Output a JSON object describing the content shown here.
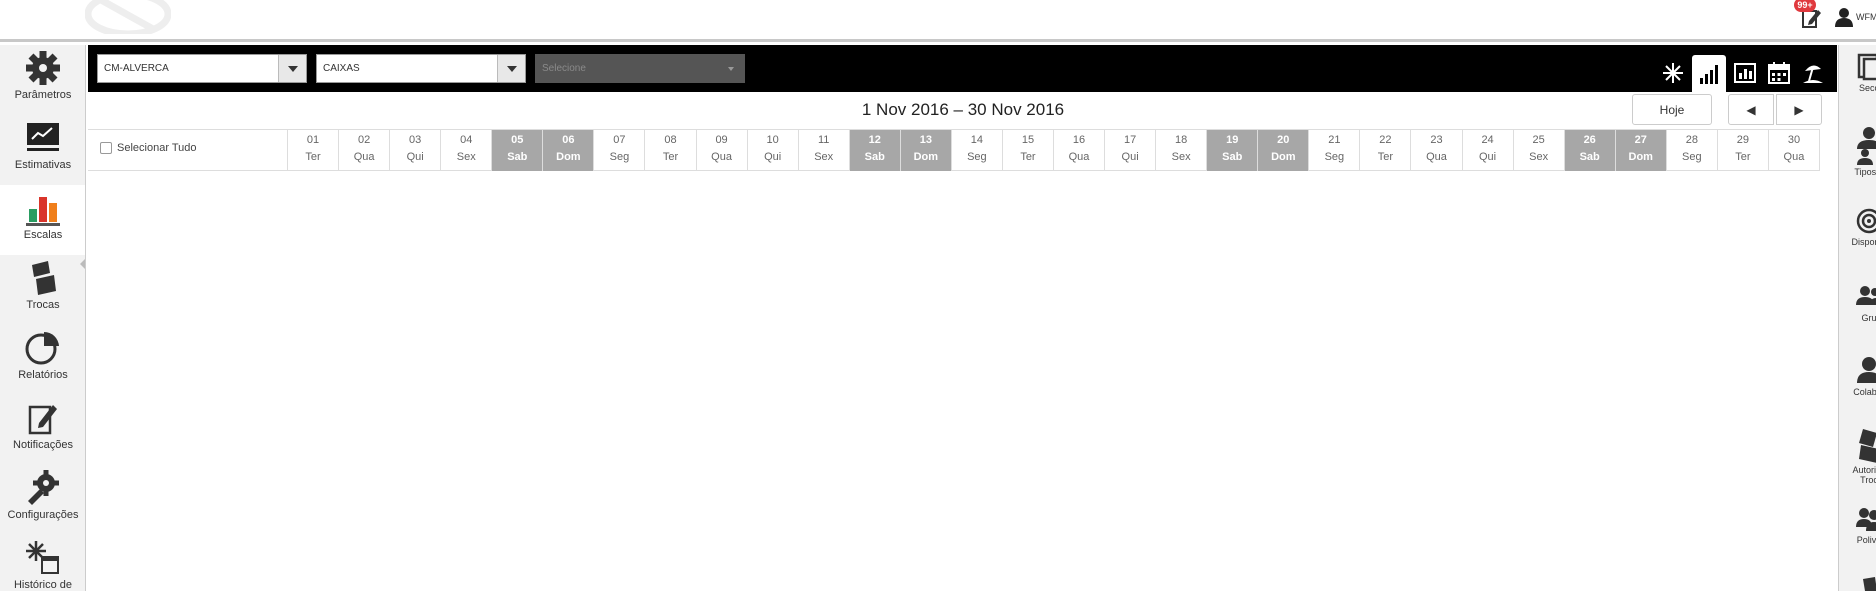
{
  "header": {
    "notifications_badge": "99+",
    "user_name": "WFM"
  },
  "left_nav": [
    {
      "id": "parametros",
      "label": "Parâmetros",
      "icon": "gear-icon"
    },
    {
      "id": "estimativas",
      "label": "Estimativas",
      "icon": "trend-chart-icon"
    },
    {
      "id": "escalas",
      "label": "Escalas",
      "icon": "bar-chart-icon",
      "active": true
    },
    {
      "id": "trocas",
      "label": "Trocas",
      "icon": "swap-cards-icon"
    },
    {
      "id": "relatorios",
      "label": "Relatórios",
      "icon": "pie-chart-icon"
    },
    {
      "id": "notificacoes",
      "label": "Notificações",
      "icon": "notification-edit-icon"
    },
    {
      "id": "configuracoes",
      "label": "Configurações",
      "icon": "wrench-gear-icon"
    },
    {
      "id": "historico",
      "label": "Histórico de",
      "icon": "history-calendar-icon"
    }
  ],
  "right_nav": [
    {
      "id": "seccoes",
      "label": "Secç",
      "icon": "sections-icon"
    },
    {
      "id": "tipos",
      "label": "Tipos d",
      "icon": "person-types-icon"
    },
    {
      "id": "disponibilidade",
      "label": "Disponib",
      "icon": "target-icon"
    },
    {
      "id": "grupos",
      "label": "Gru",
      "icon": "group-icon"
    },
    {
      "id": "colaboradores",
      "label": "Colabor",
      "icon": "person-icon"
    },
    {
      "id": "autorizacao",
      "label": "Autoriza",
      "label2": "Troc",
      "icon": "authorization-icon"
    },
    {
      "id": "polivalencia",
      "label": "Poliva",
      "icon": "multi-person-icon"
    }
  ],
  "toolbar": {
    "store_select": "CM-ALVERCA",
    "section_select": "CAIXAS",
    "third_select_placeholder": "Selecione",
    "view_buttons": [
      {
        "name": "sparkle-view-icon",
        "active": false
      },
      {
        "name": "bar-signal-view-icon",
        "active": true
      },
      {
        "name": "chart-board-view-icon",
        "active": false
      },
      {
        "name": "calendar-view-icon",
        "active": false
      },
      {
        "name": "beach-vacation-view-icon",
        "active": false
      }
    ]
  },
  "calendar": {
    "date_range": "1 Nov 2016 – 30 Nov 2016",
    "today_label": "Hoje",
    "prev_label": "◀",
    "next_label": "▶",
    "select_all_label": "Selecionar Tudo",
    "days": [
      {
        "num": "01",
        "dow": "Ter"
      },
      {
        "num": "02",
        "dow": "Qua"
      },
      {
        "num": "03",
        "dow": "Qui"
      },
      {
        "num": "04",
        "dow": "Sex"
      },
      {
        "num": "05",
        "dow": "Sab",
        "weekend": true
      },
      {
        "num": "06",
        "dow": "Dom",
        "weekend": true
      },
      {
        "num": "07",
        "dow": "Seg"
      },
      {
        "num": "08",
        "dow": "Ter"
      },
      {
        "num": "09",
        "dow": "Qua"
      },
      {
        "num": "10",
        "dow": "Qui"
      },
      {
        "num": "11",
        "dow": "Sex"
      },
      {
        "num": "12",
        "dow": "Sab",
        "weekend": true
      },
      {
        "num": "13",
        "dow": "Dom",
        "weekend": true
      },
      {
        "num": "14",
        "dow": "Seg"
      },
      {
        "num": "15",
        "dow": "Ter"
      },
      {
        "num": "16",
        "dow": "Qua"
      },
      {
        "num": "17",
        "dow": "Qui"
      },
      {
        "num": "18",
        "dow": "Sex"
      },
      {
        "num": "19",
        "dow": "Sab",
        "weekend": true
      },
      {
        "num": "20",
        "dow": "Dom",
        "weekend": true
      },
      {
        "num": "21",
        "dow": "Seg"
      },
      {
        "num": "22",
        "dow": "Ter"
      },
      {
        "num": "23",
        "dow": "Qua"
      },
      {
        "num": "24",
        "dow": "Qui"
      },
      {
        "num": "25",
        "dow": "Sex"
      },
      {
        "num": "26",
        "dow": "Sab",
        "weekend": true
      },
      {
        "num": "27",
        "dow": "Dom",
        "weekend": true
      },
      {
        "num": "28",
        "dow": "Seg"
      },
      {
        "num": "29",
        "dow": "Ter"
      },
      {
        "num": "30",
        "dow": "Qua"
      }
    ]
  },
  "colors": {
    "toolbar_bg": "#000000",
    "weekend_bg": "#a7a7a7",
    "badge": "#e0393e",
    "accent_red": "#d9352b",
    "accent_orange": "#f07f1b",
    "accent_green": "#2a9d62"
  }
}
